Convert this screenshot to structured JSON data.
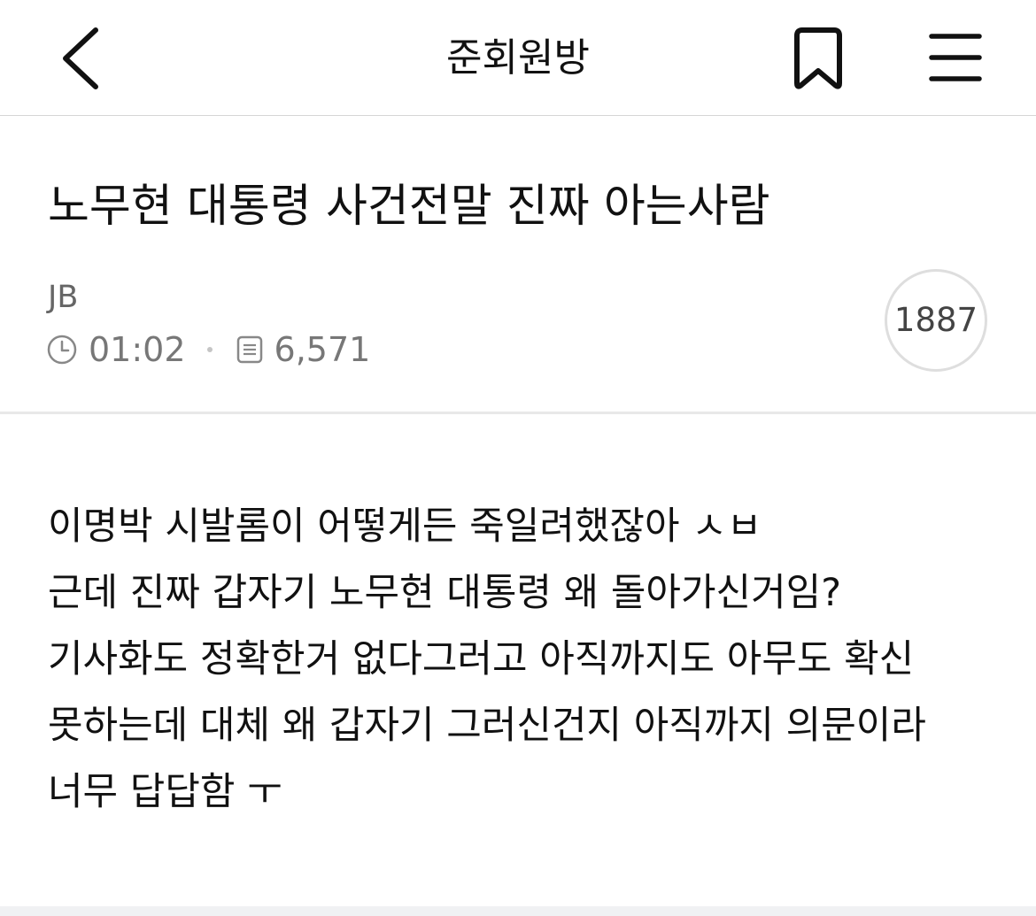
{
  "topbar": {
    "title": "준회원방",
    "back_icon": "chevron-left-icon",
    "bookmark_icon": "bookmark-icon",
    "menu_icon": "hamburger-menu-icon"
  },
  "post": {
    "title": "노무현 대통령 사건전말 진짜 아는사람",
    "author": "JB",
    "time": "01:02",
    "views": "6,571",
    "comment_count": "1887",
    "body_lines": [
      "이명박 시발롬이 어떻게든 죽일려했잖아 ㅅㅂ",
      "근데 진짜 갑자기 노무현 대통령 왜 돌아가신거임?",
      "기사화도 정확한거 없다그러고 아직까지도 아무도 확신",
      "못하는데 대체 왜 갑자기 그러신건지 아직까지 의문이라",
      "너무 답답함 ㅜ"
    ]
  },
  "colors": {
    "text_primary": "#111111",
    "text_meta": "#777777",
    "divider": "#e8e8e8"
  }
}
